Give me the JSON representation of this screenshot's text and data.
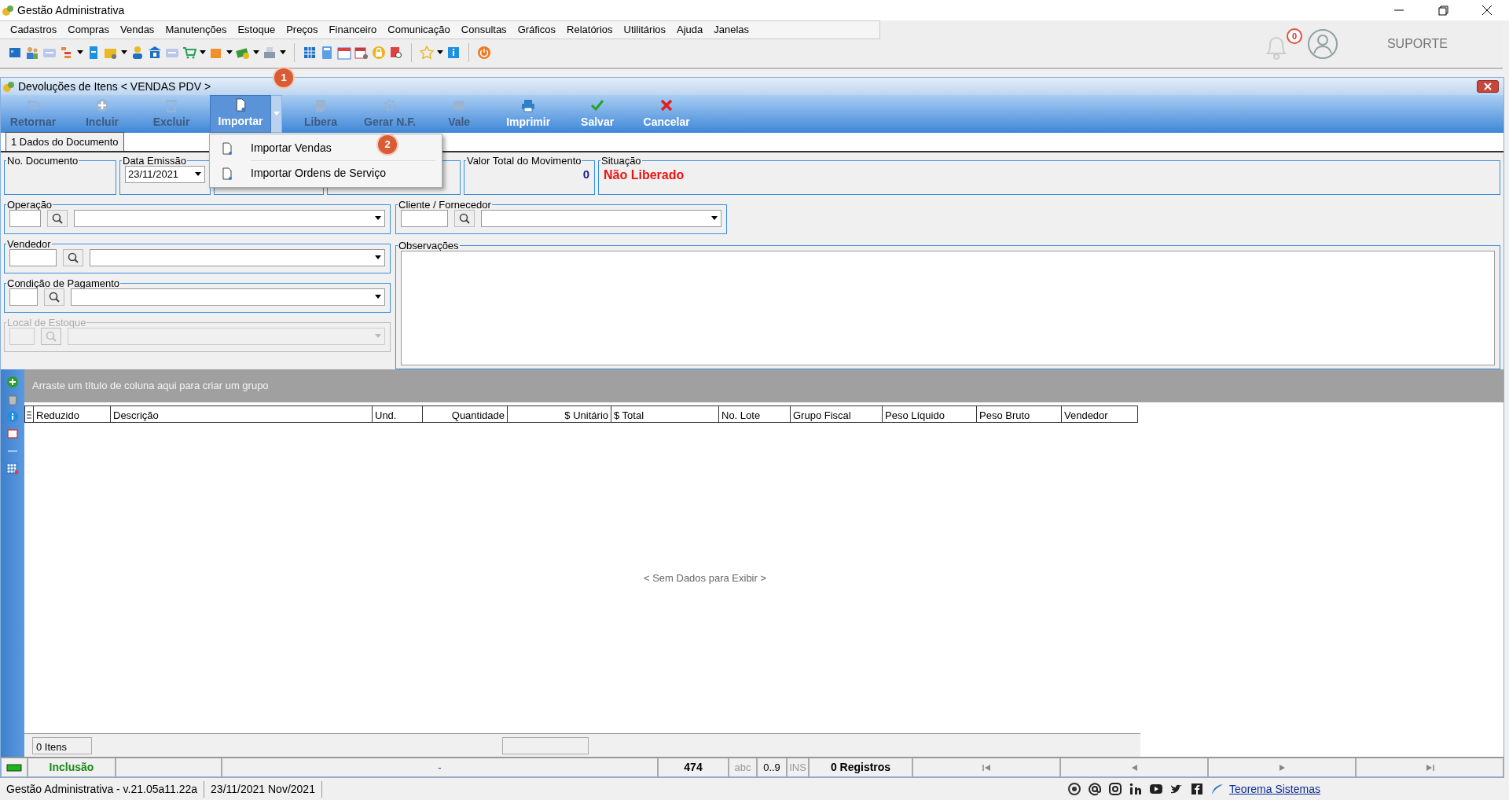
{
  "window": {
    "title": "Gestão Administrativa"
  },
  "menu": [
    "Cadastros",
    "Compras",
    "Vendas",
    "Manutenções",
    "Estoque",
    "Preços",
    "Financeiro",
    "Comunicação",
    "Consultas",
    "Gráficos",
    "Relatórios",
    "Utilitários",
    "Ajuda",
    "Janelas"
  ],
  "header": {
    "notification_count": "0",
    "user_label": "SUPORTE"
  },
  "child_window": {
    "title": "Devoluções de Itens < VENDAS PDV >"
  },
  "actions": [
    {
      "kind": "return",
      "label": "Retornar",
      "disabled": true,
      "selected": false
    },
    {
      "kind": "add",
      "label": "Incluir",
      "disabled": true,
      "selected": false
    },
    {
      "kind": "delete",
      "label": "Excluir",
      "disabled": true,
      "selected": false
    },
    {
      "kind": "import",
      "label": "Importar",
      "disabled": false,
      "selected": true
    },
    {
      "kind": "release",
      "label": "Libera",
      "disabled": true,
      "selected": false
    },
    {
      "kind": "invoice",
      "label": "Gerar N.F.",
      "disabled": true,
      "selected": false
    },
    {
      "kind": "voucher",
      "label": "Vale",
      "disabled": true,
      "selected": false
    },
    {
      "kind": "print",
      "label": "Imprimir",
      "disabled": false,
      "selected": false
    },
    {
      "kind": "save",
      "label": "Salvar",
      "disabled": false,
      "selected": false
    },
    {
      "kind": "cancel",
      "label": "Cancelar",
      "disabled": false,
      "selected": false
    }
  ],
  "dropdown": {
    "items": [
      "Importar Vendas",
      "Importar Ordens de Serviço"
    ]
  },
  "callouts": [
    "1",
    "2"
  ],
  "tabs": [
    {
      "label": "1 Dados do Documento",
      "selected": true
    }
  ],
  "form": {
    "no_documento": {
      "label": "No. Documento"
    },
    "data_emissao": {
      "label": "Data Emissão",
      "value": "23/11/2021"
    },
    "valor_total": {
      "label": "Valor Total do Movimento",
      "value": "0"
    },
    "situacao": {
      "label": "Situação",
      "value": "Não Liberado"
    },
    "lookups": [
      {
        "label": "Operação",
        "disabled": false
      },
      {
        "label": "Vendedor",
        "disabled": false
      },
      {
        "label": "Condição de Pagamento",
        "disabled": false
      },
      {
        "label": "Local de Estoque",
        "disabled": true
      }
    ],
    "cliente": {
      "label": "Cliente / Fornecedor"
    },
    "observacoes": {
      "label": "Observações"
    }
  },
  "grid": {
    "group_hint": "Arraste um título de coluna aqui para criar um grupo",
    "columns": [
      "Reduzido",
      "Descrição",
      "Und.",
      "Quantidade",
      "$ Unitário",
      "$ Total",
      "No. Lote",
      "Grupo Fiscal",
      "Peso Líquido",
      "Peso Bruto",
      "Vendedor"
    ],
    "empty_text": "< Sem Dados para Exibir >",
    "footer_count": "0 Itens"
  },
  "status_bar": {
    "mode": "Inclusão",
    "separator": "-",
    "counter": "474",
    "indicators": [
      {
        "label": "abc",
        "on": false
      },
      {
        "label": "0..9",
        "on": true
      },
      {
        "label": "INS",
        "on": false
      }
    ],
    "records": "0 Registros"
  },
  "footer": {
    "version": "Gestão Administrativa - v.21.05a11.22a",
    "date": "23/11/2021 Nov/2021",
    "link": "Teorema Sistemas"
  }
}
